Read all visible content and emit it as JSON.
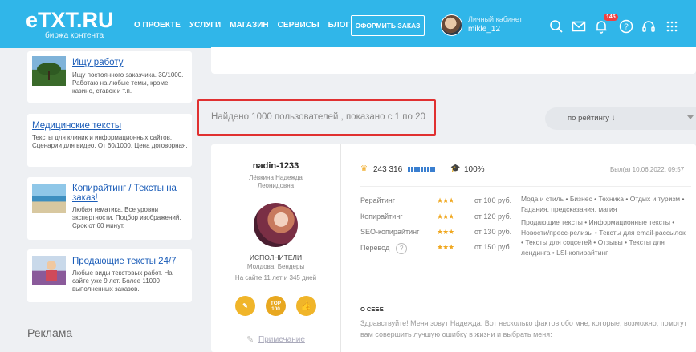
{
  "header": {
    "logo": "eTXT.RU",
    "logo_sub": "биржа контента",
    "nav": [
      "О ПРОЕКТЕ",
      "УСЛУГИ",
      "МАГАЗИН",
      "СЕРВИСЫ",
      "БЛОГ"
    ],
    "order_button": "ОФОРМИТЬ ЗАКАЗ",
    "cabinet_label": "Личный кабинет",
    "username": "mikle_12",
    "notification_count": "145",
    "icons": [
      "search-icon",
      "mail-icon",
      "bell-icon",
      "help-icon",
      "headset-icon",
      "grid-icon"
    ]
  },
  "sidebar": {
    "cards": [
      {
        "title": "Ищу работу",
        "text": "Ищу постоянного заказчика. 30/1000. Работаю на любые темы, кроме казино, ставок и т.п.",
        "has_thumb": true
      },
      {
        "title": "Медицинские тексты",
        "text": "Тексты для клиник и информационных сайтов. Сценарии для видео. От 60/1000. Цена договорная.",
        "has_thumb": false
      },
      {
        "title": "Копирайтинг / Тексты на заказ!",
        "text": "Любая тематика. Все уровни экспертности. Подбор изображений. Срок от 60 минут.",
        "has_thumb": true
      },
      {
        "title": "Продающие тексты 24/7",
        "text": "Любые виды текстовых работ. На сайте уже 9 лет. Более 11000 выполненных заказов.",
        "has_thumb": true
      }
    ],
    "ads_label": "Реклама"
  },
  "results": {
    "found_text": "Найдено 1000 пользователей , показано с 1 по 20",
    "sort_label": "по рейтингу ↓"
  },
  "user": {
    "login": "nadin-1233",
    "real_name": "Лёвкина Надежда Леонидовна",
    "role": "ИСПОЛНИТЕЛИ",
    "location": "Молдова, Бендеры",
    "since": "На сайте 11 лет и 345 дней",
    "medals": [
      "✎",
      "TOP 100",
      "👍"
    ],
    "note": "Примечание",
    "rating": "243 316",
    "rating_level": 0.7,
    "percent": "100%",
    "last_seen": "Был(а) 10.06.2022, 09:57",
    "services": [
      {
        "name": "Рерайтинг",
        "stars": "★★★",
        "price": "от 100 руб."
      },
      {
        "name": "Копирайтинг",
        "stars": "★★★",
        "price": "от 120 руб."
      },
      {
        "name": "SEO-копирайтинг",
        "stars": "★★★",
        "price": "от 130 руб."
      },
      {
        "name": "Перевод",
        "stars": "★★★",
        "price": "от 150 руб."
      }
    ],
    "categories": "Мода и стиль • Бизнес • Техника • Отдых и туризм • Гадания, предсказания, магия",
    "categories2": "Продающие тексты • Информационные тексты • Новости/пресс-релизы • Тексты для email-рассылок • Тексты для соцсетей • Отзывы • Тексты для лендинга • LSI-копирайтинг",
    "about_heading": "О СЕБЕ",
    "about_text": "Здравствуйте! Меня зовут Надежда. Вот несколько фактов обо мне, которые, возможно, помогут вам совершить лучшую ошибку в жизни и выбрать меня:"
  }
}
